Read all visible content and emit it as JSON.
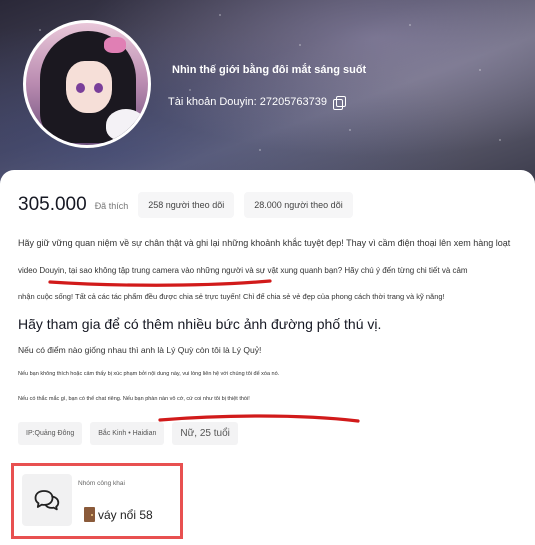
{
  "profile": {
    "nickname": "Nhìn thế giới bằng đôi mắt sáng suốt",
    "account_label": "Tài khoản Douyin: 27205763739"
  },
  "stats": {
    "likes_value": "305.000",
    "likes_label": "Đã thích",
    "following": "258 người theo dõi",
    "followers": "28.000 người theo dõi"
  },
  "bio": {
    "line1": "Hãy giữ vững quan niệm về sự chân thật và ghi lại những khoảnh khắc tuyệt đẹp! Thay vì cầm điện thoại lên xem hàng loạt",
    "line2": "video Douyin, tại sao không tập trung camera vào những người và sự vật xung quanh bạn? Hãy chú ý đến từng chi tiết và cảm",
    "line3": "nhận cuộc sống! Tất cả các tác phẩm đều được chia sẻ trực tuyến! Chỉ để chia sẻ vẻ đẹp của phong cách thời trang và kỹ năng!",
    "heading": "Hãy tham gia để có thêm nhiều bức ảnh đường phố thú vị.",
    "line4": "Nếu có điểm nào giống nhau thì anh là Lý Quỳ còn tôi là Lý Quỷ!",
    "line5": "Nếu bạn không thích hoặc cảm thấy bị xúc phạm bởi nội dung này, vui lòng liên hệ với chúng tôi để xóa nó.",
    "line6": "Nếu có thắc mắc gì, bạn có thể chat riêng. Nếu bạn phàn nàn vô cớ, cứ coi như tôi bị thiệt thòi!"
  },
  "tags": {
    "ip": "IP:Quảng Đông",
    "location": "Bắc Kinh • Haidian",
    "gender_age": "Nữ, 25 tuổi"
  },
  "group": {
    "label": "Nhóm công khai",
    "name": "váy nổi 58"
  },
  "icons": {
    "copy": "copy-icon",
    "group_chat": "chat-bubbles-icon",
    "door": "door-emoji-icon"
  },
  "colors": {
    "highlight": "#e85050",
    "stroke": "#d11a1a"
  }
}
